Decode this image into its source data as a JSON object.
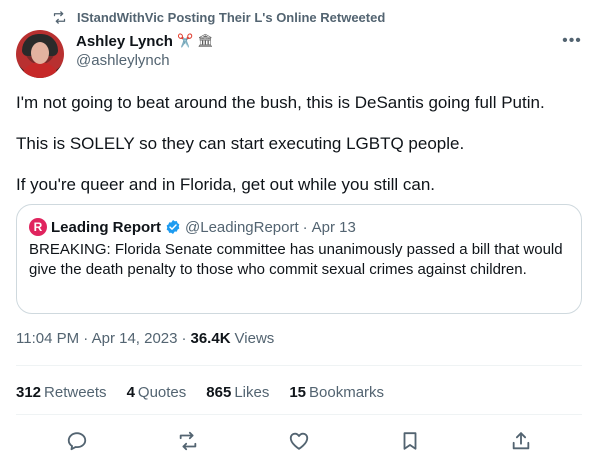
{
  "retweet": {
    "text": "IStandWithVic Posting Their L's Online Retweeted"
  },
  "author": {
    "name": "Ashley Lynch",
    "emoji": "✂️ 🏛",
    "handle": "@ashleylynch"
  },
  "tweet": {
    "paragraphs": [
      "I'm not going to beat around the bush, this is DeSantis going full Putin.",
      "This is SOLELY so they can start executing LGBTQ people.",
      "If you're queer and in Florida, get out while you still can."
    ]
  },
  "quote": {
    "logo": "R",
    "name": "Leading Report",
    "handle": "@LeadingReport",
    "separator": "·",
    "date": "Apr 13",
    "text": "BREAKING: Florida Senate committee has unanimously passed a bill that would give the death penalty to those who commit sexual crimes against children."
  },
  "meta": {
    "timestamp": "11:04 PM · Apr 14, 2023",
    "dot": "·",
    "views_count": "36.4K",
    "views_label": "Views"
  },
  "stats": [
    {
      "count": "312",
      "label": "Retweets"
    },
    {
      "count": "4",
      "label": "Quotes"
    },
    {
      "count": "865",
      "label": "Likes"
    },
    {
      "count": "15",
      "label": "Bookmarks"
    }
  ],
  "actions": [
    "reply-icon",
    "retweet-icon",
    "like-icon",
    "bookmark-icon",
    "share-icon"
  ],
  "colors": {
    "text": "#0f1419",
    "secondary": "#536471",
    "border": "#cfd9de",
    "divider": "#eff3f4",
    "verified": "#1d9bf0",
    "logo": "#e0245e"
  }
}
